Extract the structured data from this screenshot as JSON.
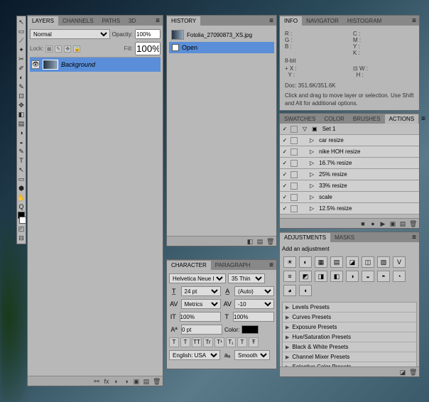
{
  "toolbox": {
    "tools": [
      "▭",
      "⬚",
      "⟋",
      "↖",
      "✂",
      "✎",
      "✐",
      "✦",
      "◧",
      "⌖",
      "T",
      "◑",
      "✥",
      "⬛",
      "◰",
      "◐",
      "✋",
      "⊡",
      "⊟",
      "Q"
    ]
  },
  "layers": {
    "tabs": [
      "LAYERS",
      "CHANNELS",
      "PATHS",
      "3D"
    ],
    "active_tab": 0,
    "blend_mode": "Normal",
    "opacity_label": "Opacity:",
    "opacity_value": "100%",
    "lock_label": "Lock:",
    "fill_label": "Fill:",
    "fill_value": "100%",
    "layer_name": "Background"
  },
  "history": {
    "tabs": [
      "HISTORY"
    ],
    "doc_name": "Fotolia_27090873_XS.jpg",
    "item": "Open"
  },
  "info": {
    "tabs": [
      "INFO",
      "NAVIGATOR",
      "HISTOGRAM"
    ],
    "active_tab": 0,
    "r": "R :",
    "g": "G :",
    "b": "B :",
    "c": "C :",
    "m": "M :",
    "y": "Y :",
    "k": "K :",
    "bits": "8-bit",
    "x": "X :",
    "yv": "Y :",
    "w": "W :",
    "h": "H :",
    "doc": "Doc: 351.6K/351.6K",
    "hint": "Click and drag to move layer or selection.  Use Shift and Alt for additional options."
  },
  "swatches": {
    "tabs": [
      "SWATCHES",
      "COLOR",
      "BRUSHES",
      "ACTIONS"
    ],
    "active_tab": 3,
    "set": "Set 1",
    "actions": [
      "car resize",
      "nike HOH resize",
      "16.7% resize",
      "25% resize",
      "33% resize",
      "scale",
      "12.5% resize"
    ]
  },
  "adjustments": {
    "tabs": [
      "ADJUSTMENTS",
      "MASKS"
    ],
    "active_tab": 0,
    "heading": "Add an adjustment",
    "buttons": [
      "☀",
      "◐",
      "▦",
      "▤",
      "◪",
      "◫",
      "▨",
      "V",
      "≡",
      "◩",
      "◨",
      "◧",
      "◑",
      "◒",
      "◓",
      "◔",
      "◕",
      "◖"
    ],
    "presets": [
      "Levels Presets",
      "Curves Presets",
      "Exposure Presets",
      "Hue/Saturation Presets",
      "Black & White Presets",
      "Channel Mixer Presets",
      "Selective Color Presets"
    ]
  },
  "character": {
    "tabs": [
      "CHARACTER",
      "PARAGRAPH"
    ],
    "active_tab": 0,
    "font": "Helvetica Neue L…",
    "style": "35 Thin",
    "size": "24 pt",
    "leading": "(Auto)",
    "kerning": "Metrics",
    "tracking": "-10",
    "vscale": "100%",
    "hscale": "100%",
    "baseline": "0 pt",
    "color_label": "Color:",
    "lang": "English: USA",
    "aa_label": "aₐ",
    "aa": "Smooth",
    "type_btns": [
      "T",
      "T",
      "TT",
      "Tr",
      "T¹",
      "T₁",
      "T",
      "Ŧ"
    ]
  }
}
